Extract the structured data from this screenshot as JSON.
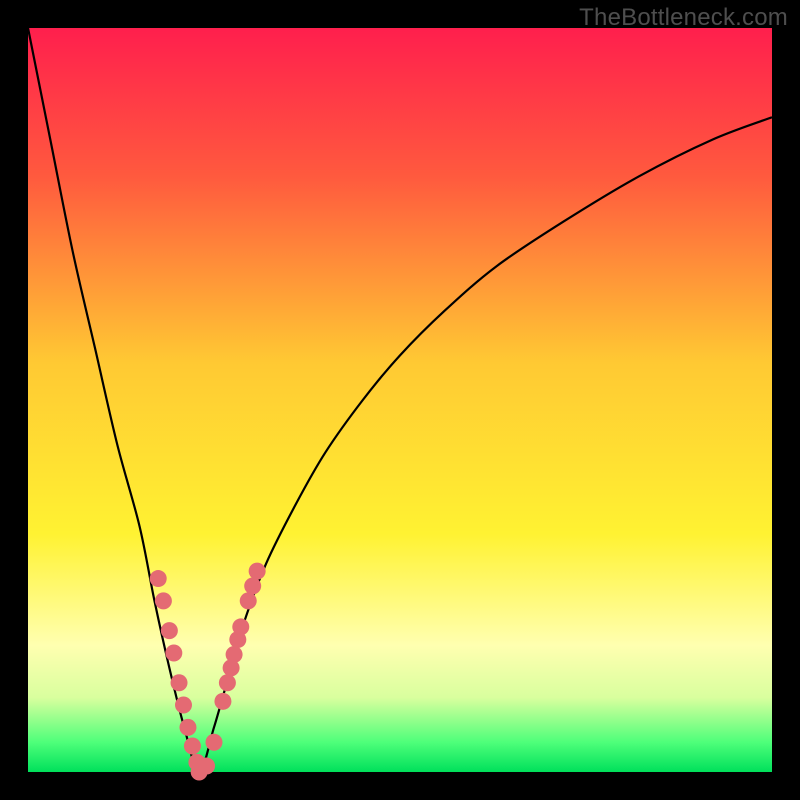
{
  "watermark": "TheBottleneck.com",
  "colors": {
    "frame": "#000000",
    "gradient_stops": [
      {
        "pct": 0,
        "color": "#ff1f4d"
      },
      {
        "pct": 20,
        "color": "#ff5a3e"
      },
      {
        "pct": 45,
        "color": "#ffc933"
      },
      {
        "pct": 68,
        "color": "#fff232"
      },
      {
        "pct": 83,
        "color": "#ffffb0"
      },
      {
        "pct": 90,
        "color": "#d9ff9e"
      },
      {
        "pct": 96,
        "color": "#4eff7a"
      },
      {
        "pct": 100,
        "color": "#00e05b"
      }
    ],
    "curve": "#000000",
    "marker": "#e46a73"
  },
  "chart_data": {
    "type": "line",
    "title": "",
    "xlabel": "",
    "ylabel": "",
    "xlim": [
      0,
      100
    ],
    "ylim": [
      0,
      100
    ],
    "x_min_point": 23,
    "series": [
      {
        "name": "bottleneck-curve",
        "x": [
          0,
          3,
          6,
          9,
          12,
          15,
          17,
          19,
          21,
          23,
          25,
          27,
          29,
          32,
          36,
          40,
          45,
          50,
          56,
          63,
          72,
          82,
          92,
          100
        ],
        "y": [
          100,
          85,
          70,
          57,
          44,
          33,
          23,
          14,
          6,
          0,
          6,
          13,
          20,
          28,
          36,
          43,
          50,
          56,
          62,
          68,
          74,
          80,
          85,
          88
        ]
      }
    ],
    "markers": {
      "name": "highlighted-points",
      "x": [
        17.5,
        18.2,
        19.0,
        19.6,
        20.3,
        20.9,
        21.5,
        22.1,
        22.7,
        23.0,
        24.0,
        25.0,
        26.2,
        26.8,
        27.3,
        27.7,
        28.2,
        28.6,
        29.6,
        30.2,
        30.8
      ],
      "y": [
        26,
        23,
        19,
        16,
        12,
        9,
        6,
        3.5,
        1.3,
        0,
        0.8,
        4.0,
        9.5,
        12.0,
        14.0,
        15.8,
        17.8,
        19.5,
        23.0,
        25.0,
        27.0
      ]
    }
  }
}
